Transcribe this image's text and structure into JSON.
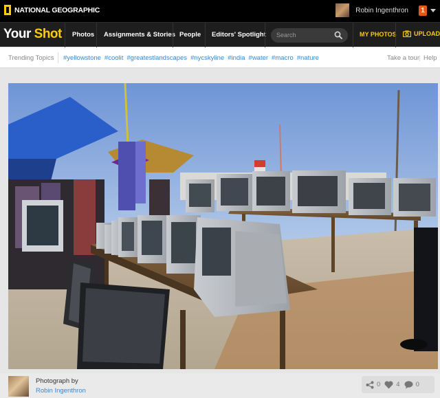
{
  "header": {
    "logo_text": "NATIONAL GEOGRAPHIC",
    "user_name": "Robin Ingenthron",
    "notification_count": "1"
  },
  "nav": {
    "brand_word1": "Your",
    "brand_word2": "Shot",
    "items": [
      {
        "label": "Photos"
      },
      {
        "label": "Assignments & Stories"
      },
      {
        "label": "People"
      },
      {
        "label": "Editors' Spotlight"
      }
    ],
    "search_placeholder": "Search",
    "my_photos": "MY PHOTOS",
    "upload": "UPLOAD"
  },
  "trending": {
    "label": "Trending Topics",
    "tags": [
      "#yellowstone",
      "#coolit",
      "#greatestlandscapes",
      "#nycskyline",
      "#india",
      "#water",
      "#macro",
      "#nature"
    ],
    "take_tour": "Take a tour",
    "separator": "|",
    "help": "Help"
  },
  "photo_footer": {
    "photo_by_label": "Photograph by",
    "photographer": "Robin Ingenthron",
    "shares": "0",
    "likes": "4",
    "comments": "0"
  },
  "colors": {
    "accent": "#ffcc00",
    "link": "#3f86c7",
    "notification": "#e05a1c",
    "topbar": "#000000",
    "navbar": "#1e1e1e"
  }
}
